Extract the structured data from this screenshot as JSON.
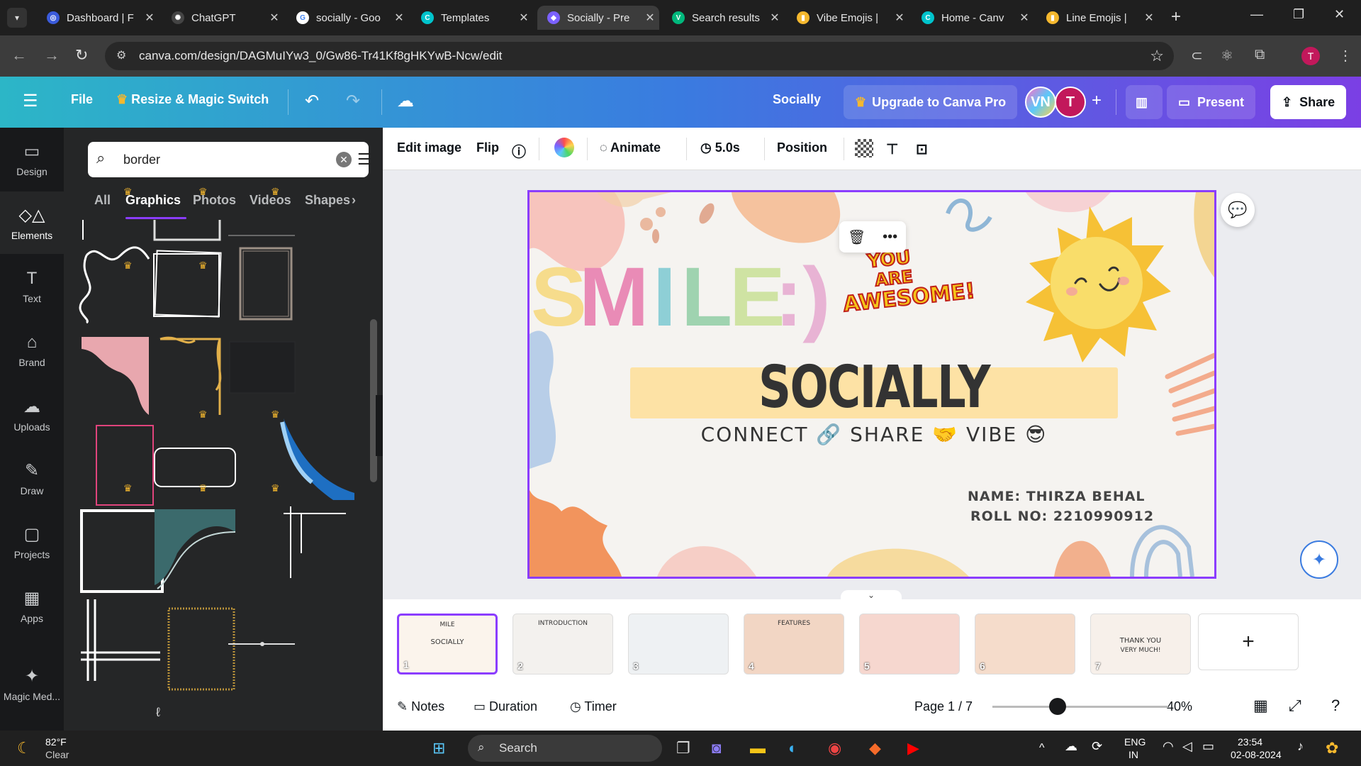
{
  "browser": {
    "tabs": [
      {
        "title": "Dashboard | F",
        "color": "#3b5bdb",
        "glyph": "◎"
      },
      {
        "title": "ChatGPT",
        "color": "#444444",
        "glyph": "✺"
      },
      {
        "title": "socially - Goo",
        "color": "#ffffff",
        "glyph": "G"
      },
      {
        "title": "Templates",
        "color": "#00c4cc",
        "glyph": "C"
      },
      {
        "title": "Socially - Pre",
        "color": "#7b61ff",
        "glyph": "◆"
      },
      {
        "title": "Search results",
        "color": "#00b87c",
        "glyph": "V"
      },
      {
        "title": "Vibe Emojis |",
        "color": "#f5b82e",
        "glyph": "▮"
      },
      {
        "title": "Home - Canv",
        "color": "#00c4cc",
        "glyph": "C"
      },
      {
        "title": "Line Emojis |",
        "color": "#f5b82e",
        "glyph": "▮"
      }
    ],
    "url": "canva.com/design/DAGMuIYw3_0/Gw86-Tr41Kf8gHKYwB-Ncw/edit",
    "profile_initial": "T"
  },
  "canva": {
    "menu_icon": "hamburger-icon",
    "file": "File",
    "resize": "Resize & Magic Switch",
    "doc_title": "Socially",
    "upgrade": "Upgrade to Canva Pro",
    "avatar1": "VN",
    "avatar2": "T",
    "present": "Present",
    "share": "Share"
  },
  "rail": [
    {
      "label": "Design",
      "icon": "▭"
    },
    {
      "label": "Elements",
      "icon": "◇△"
    },
    {
      "label": "Text",
      "icon": "T"
    },
    {
      "label": "Brand",
      "icon": "⌂"
    },
    {
      "label": "Uploads",
      "icon": "☁"
    },
    {
      "label": "Draw",
      "icon": "✎"
    },
    {
      "label": "Projects",
      "icon": "▢"
    },
    {
      "label": "Apps",
      "icon": "▦"
    },
    {
      "label": "Magic Med...",
      "icon": "✦"
    }
  ],
  "panel": {
    "search_value": "border",
    "tabs": [
      "All",
      "Graphics",
      "Photos",
      "Videos",
      "Shapes"
    ],
    "active_tab": "Graphics"
  },
  "toolbar": {
    "edit_image": "Edit image",
    "flip": "Flip",
    "animate": "Animate",
    "duration": "5.0s",
    "position": "Position"
  },
  "design": {
    "smile_letters": [
      "S",
      "M",
      "I",
      "L",
      "E"
    ],
    "smile_colors": [
      "#f6dc8c",
      "#e98bb6",
      "#8ecfd6",
      "#9fd3b0",
      "#cfe3a3"
    ],
    "smiley": ":)",
    "sticker_line1": "YOU",
    "sticker_line2": "ARE",
    "sticker_line3": "AWESOME!",
    "title": "SOCIALLY",
    "tagline": "CONNECT 🔗  SHARE 🤝  VIBE 😎",
    "name_line": "NAME: THIRZA BEHAL",
    "roll_line": "ROLL NO: 2210990912"
  },
  "pages": [
    {
      "num": "1",
      "label": "SOCIALLY",
      "sub": "MILE"
    },
    {
      "num": "2",
      "label": "INTRODUCTION",
      "sub": ""
    },
    {
      "num": "3",
      "label": "",
      "sub": ""
    },
    {
      "num": "4",
      "label": "FEATURES",
      "sub": ""
    },
    {
      "num": "5",
      "label": "",
      "sub": ""
    },
    {
      "num": "6",
      "label": "",
      "sub": ""
    },
    {
      "num": "7",
      "label": "THANK YOU",
      "sub": "VERY MUCH!"
    }
  ],
  "footer": {
    "notes": "Notes",
    "duration": "Duration",
    "timer": "Timer",
    "page": "Page 1 / 7",
    "zoom": "40%"
  },
  "taskbar": {
    "temp": "82°F",
    "weather": "Clear",
    "search": "Search",
    "lang1": "ENG",
    "lang2": "IN",
    "time": "23:54",
    "date": "02-08-2024"
  }
}
